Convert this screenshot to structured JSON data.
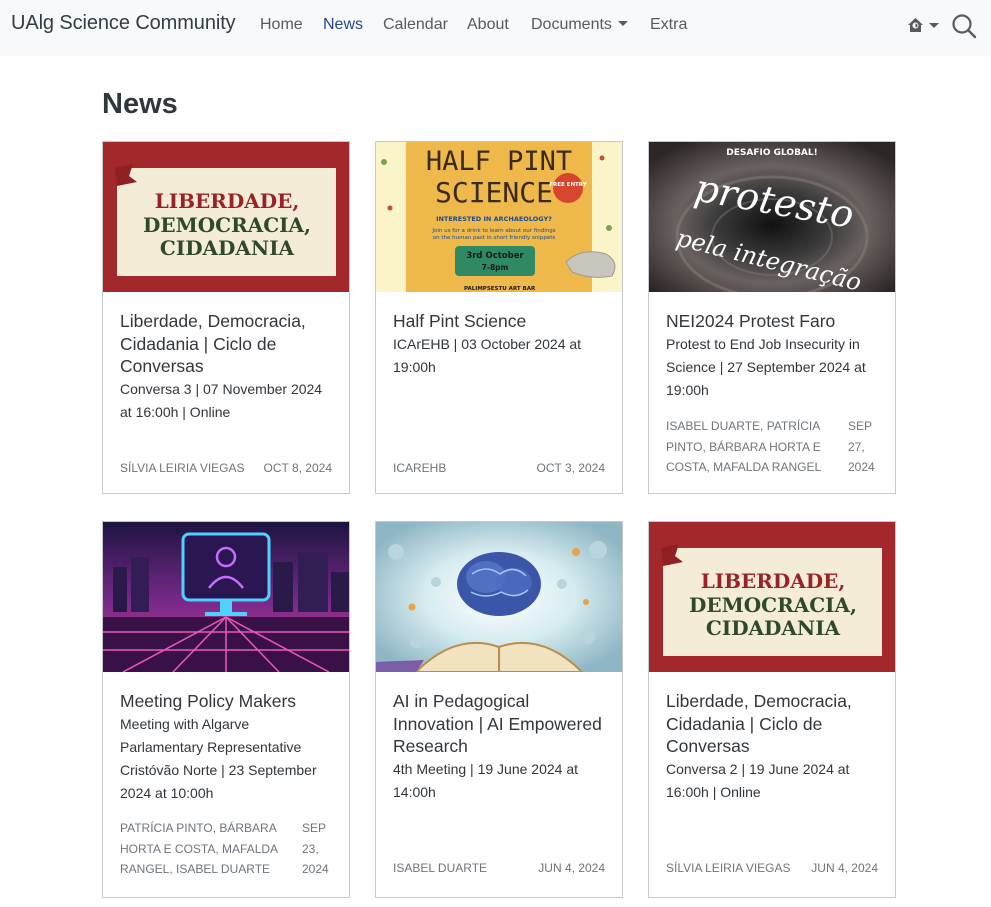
{
  "navbar": {
    "brand": "UAlg Science Community",
    "links": [
      {
        "label": "Home"
      },
      {
        "label": "News",
        "active": true
      },
      {
        "label": "Calendar"
      },
      {
        "label": "About"
      },
      {
        "label": "Documents"
      },
      {
        "label": "Extra"
      }
    ],
    "icons": {
      "theme": "home-theme-icon",
      "search": "search-icon"
    }
  },
  "page": {
    "title": "News"
  },
  "cards": [
    {
      "image": "liberdade-banner-image",
      "image_text": [
        "LIBERDADE,",
        "DEMOCRACIA,",
        "CIDADANIA"
      ],
      "title": "Liberdade, Democracia, Cidadania | Ciclo de Conversas",
      "description": "Conversa 3 | 07 November 2024 at 16:00h | Online",
      "author": "Sílvia Leiria Viegas",
      "date": "Oct 8, 2024"
    },
    {
      "image": "half-pint-science-poster-image",
      "image_text": [
        "HALF PINT",
        "SCIENCE",
        "FREE ENTRY",
        "INTERESTED IN ARCHAEOLOGY?",
        "Join us for a drink to learn about our findings",
        "on the human past in short friendly snippets",
        "3rd October",
        "7-8pm",
        "PALIMPSESTU ART BAR"
      ],
      "title": "Half Pint Science",
      "description": "ICArEHB | 03 October 2024 at 19:00h",
      "author": "ICArEHB",
      "date": "Oct 3, 2024"
    },
    {
      "image": "protesto-pela-integracao-image",
      "image_text": [
        "DESAFIO GLOBAL!",
        "protesto",
        "pela integração"
      ],
      "title": "NEI2024 Protest Faro",
      "description": "Protest to End Job Insecurity in Science | 27 September 2024 at 19:00h",
      "author": "Isabel Duarte, Patrícia Pinto, Bárbara Horta e Costa, Mafalda Rangel",
      "date": "Sep 27, 2024"
    },
    {
      "image": "neon-policy-makers-image",
      "title": "Meeting Policy Makers",
      "description": "Meeting with Algarve Parlamentary Representative Cristóvão Norte | 23 September 2024 at 10:00h",
      "author": "Patrícia Pinto, Bárbara Horta e Costa, Mafalda Rangel, Isabel Duarte",
      "date": "Sep 23, 2024"
    },
    {
      "image": "ai-brain-book-image",
      "title": "AI in Pedagogical Innovation | AI Empowered Research",
      "description": "4th Meeting | 19 June 2024 at 14:00h",
      "author": "Isabel Duarte",
      "date": "Jun 4, 2024"
    },
    {
      "image": "liberdade-banner-image",
      "image_text": [
        "LIBERDADE,",
        "DEMOCRACIA,",
        "CIDADANIA"
      ],
      "title": "Liberdade, Democracia, Cidadania | Ciclo de Conversas",
      "description": "Conversa 2 | 19 June 2024 at 16:00h | Online",
      "author": "Sílvia Leiria Viegas",
      "date": "Jun 4, 2024"
    }
  ]
}
